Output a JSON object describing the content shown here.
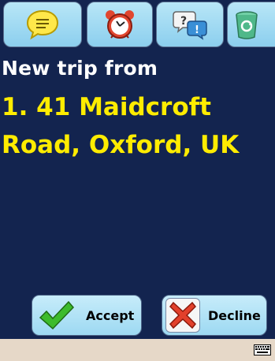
{
  "toolbar": {
    "buttons": [
      {
        "icon": "message-icon"
      },
      {
        "icon": "alarm-clock-icon"
      },
      {
        "icon": "help-speech-icon"
      },
      {
        "icon": "recycle-bin-icon"
      }
    ]
  },
  "trip": {
    "heading": "New trip from",
    "address": "1. 41 Maidcroft\nRoad, Oxford, UK"
  },
  "actions": {
    "accept_label": "Accept",
    "decline_label": "Decline"
  },
  "colors": {
    "background": "#13244f",
    "address_text": "#ffec00",
    "button_fill": "#9dd9f2",
    "statusbar": "#e6d8c8"
  },
  "statusbar": {
    "icon": "keyboard-icon"
  }
}
